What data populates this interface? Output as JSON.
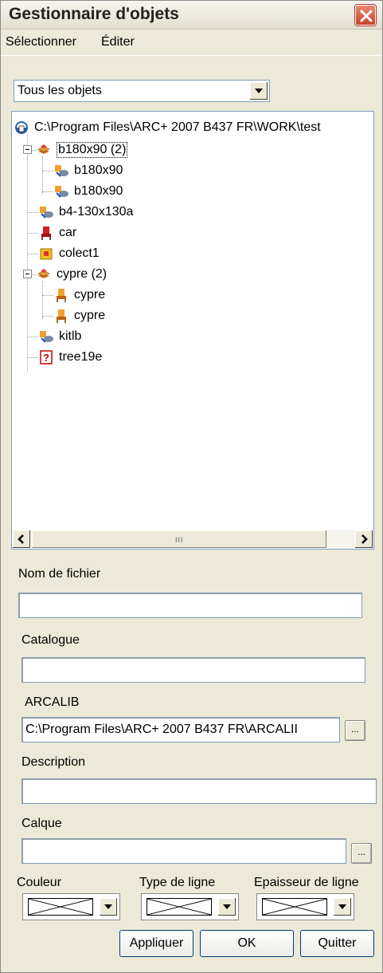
{
  "window": {
    "title": "Gestionnaire d'objets"
  },
  "menu": {
    "items": [
      "Sélectionner",
      "Éditer"
    ]
  },
  "filter": {
    "selected": "Tous les objets"
  },
  "tree": {
    "root": "C:\\Program Files\\ARC+ 2007 B437 FR\\WORK\\test",
    "nodes": [
      {
        "label": "b180x90 (2)",
        "icon": "layers-icon"
      },
      {
        "label": "b180x90",
        "icon": "block-icon"
      },
      {
        "label": "b180x90",
        "icon": "block-icon"
      },
      {
        "label": "b4-130x130a",
        "icon": "block-icon"
      },
      {
        "label": "car",
        "icon": "chair-icon"
      },
      {
        "label": "colect1",
        "icon": "collection-icon"
      },
      {
        "label": "cypre (2)",
        "icon": "layers-icon"
      },
      {
        "label": "cypre",
        "icon": "chair-icon"
      },
      {
        "label": "cypre",
        "icon": "chair-icon"
      },
      {
        "label": "kitlb",
        "icon": "block-icon"
      },
      {
        "label": "tree19e",
        "icon": "unknown-icon"
      }
    ]
  },
  "form": {
    "nom_label": "Nom de fichier",
    "nom_value": "",
    "catalogue_label": "Catalogue",
    "catalogue_value": "",
    "arcalib_label": "ARCALIB",
    "arcalib_value": "C:\\Program Files\\ARC+ 2007 B437 FR\\ARCALII",
    "browse_label": "...",
    "description_label": "Description",
    "description_value": "",
    "calque_label": "Calque",
    "calque_value": "",
    "couleur_label": "Couleur",
    "type_ligne_label": "Type de ligne",
    "epaisseur_label": "Epaisseur de ligne"
  },
  "buttons": {
    "apply": "Appliquer",
    "ok": "OK",
    "quit": "Quitter"
  },
  "scrollbar": {
    "grip": "III"
  }
}
